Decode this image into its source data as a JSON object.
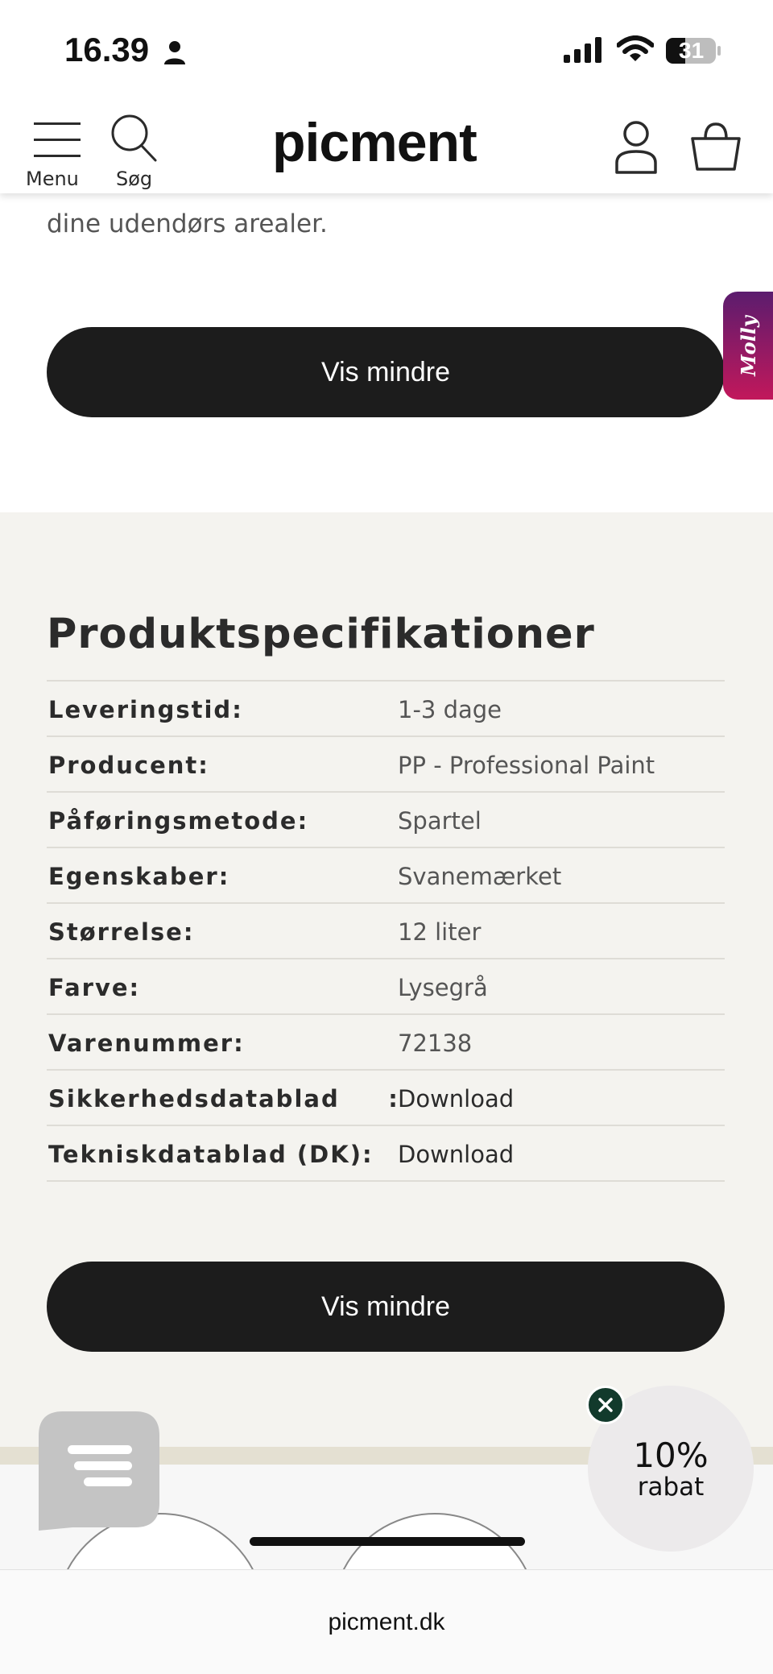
{
  "status_bar": {
    "time": "16.39",
    "battery": "31"
  },
  "header": {
    "menu_label": "Menu",
    "search_label": "Søg",
    "logo": "picment",
    "icons": [
      "hamburger-menu-icon",
      "search-icon",
      "account-icon",
      "cart-icon"
    ]
  },
  "description": {
    "tail_text": "dine udendørs arealer.",
    "show_less_label": "Vis mindre"
  },
  "molly_tab": {
    "label": "Molly"
  },
  "specs": {
    "title": "Produktspecifikationer",
    "rows": [
      {
        "label": "Leveringstid:",
        "value": "1-3 dage"
      },
      {
        "label": "Producent:",
        "value": "PP - Professional Paint"
      },
      {
        "label": "Påføringsmetode:",
        "value": "Spartel"
      },
      {
        "label": "Egenskaber:",
        "value": "Svanemærket"
      },
      {
        "label": "Størrelse:",
        "value": "12 liter"
      },
      {
        "label": "Farve:",
        "value": "Lysegrå"
      },
      {
        "label": "Varenummer:",
        "value": "72138"
      },
      {
        "label": "Sikkerhedsdatablad     :",
        "value": "Download"
      },
      {
        "label": "Tekniskdatablad (DK):",
        "value": "Download"
      }
    ],
    "show_less_label": "Vis mindre"
  },
  "discount": {
    "percent": "10%",
    "label": "rabat"
  },
  "browser": {
    "url": "picment.dk"
  },
  "colors": {
    "primary_button": "#1c1c1c",
    "spec_background": "#f4f3ef",
    "molly_gradient_top": "#5b1c6e",
    "molly_gradient_bottom": "#c2185b",
    "discount_close": "#123a2c"
  }
}
